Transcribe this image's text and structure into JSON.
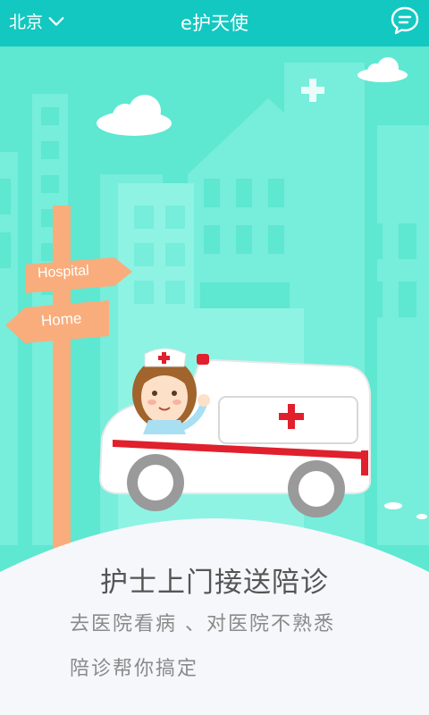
{
  "topbar": {
    "city": "北京",
    "title": "e护天使",
    "message_icon": "chat-bubble-icon",
    "dropdown_icon": "chevron-down-icon"
  },
  "sign": {
    "hospital": "Hospital",
    "home": "Home"
  },
  "promo": {
    "headline": "护士上门接送陪诊",
    "line1": "去医院看病 、对医院不熟悉",
    "line2": "陪诊帮你搞定"
  },
  "colors": {
    "topbar": "#13c8c0",
    "sky": "#5ee7d1",
    "sign": "#f9ad7c",
    "accent_red": "#e0202d"
  }
}
